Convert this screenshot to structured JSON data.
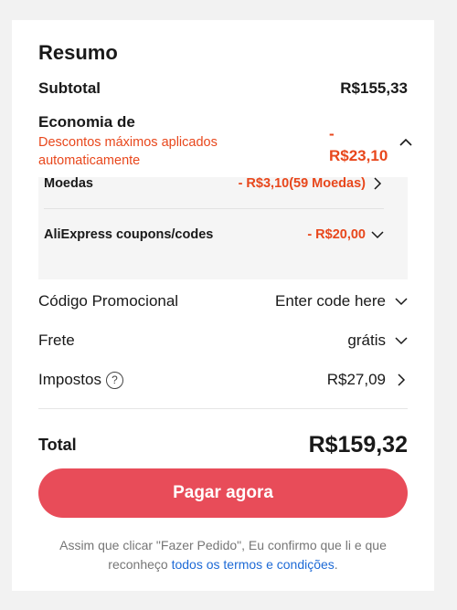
{
  "summary": {
    "title": "Resumo",
    "subtotal_label": "Subtotal",
    "subtotal_value": "R$155,33",
    "savings_label": "Economia de",
    "savings_desc": "Descontos máximos aplicados automaticamente",
    "savings_sign": "-",
    "savings_value": "R$23,10",
    "coins_label": "Moedas",
    "coins_value": "- R$3,10(59 Moedas)",
    "coupons_label": "AliExpress coupons/codes",
    "coupons_value": "- R$20,00",
    "promo_label": "Código Promocional",
    "promo_value": "Enter code here",
    "shipping_label": "Frete",
    "shipping_value": "grátis",
    "taxes_label": "Impostos",
    "taxes_help": "?",
    "taxes_value": "R$27,09",
    "total_label": "Total",
    "total_value": "R$159,32",
    "pay_button": "Pagar agora",
    "legal_text": "Assim que clicar \"Fazer Pedido\", Eu confirmo que li e que reconheço",
    "legal_link": "todos os termos e condições",
    "legal_end": "."
  },
  "colors": {
    "accent": "#e84c59",
    "discount": "#e8471c",
    "link": "#1d6ad6"
  }
}
